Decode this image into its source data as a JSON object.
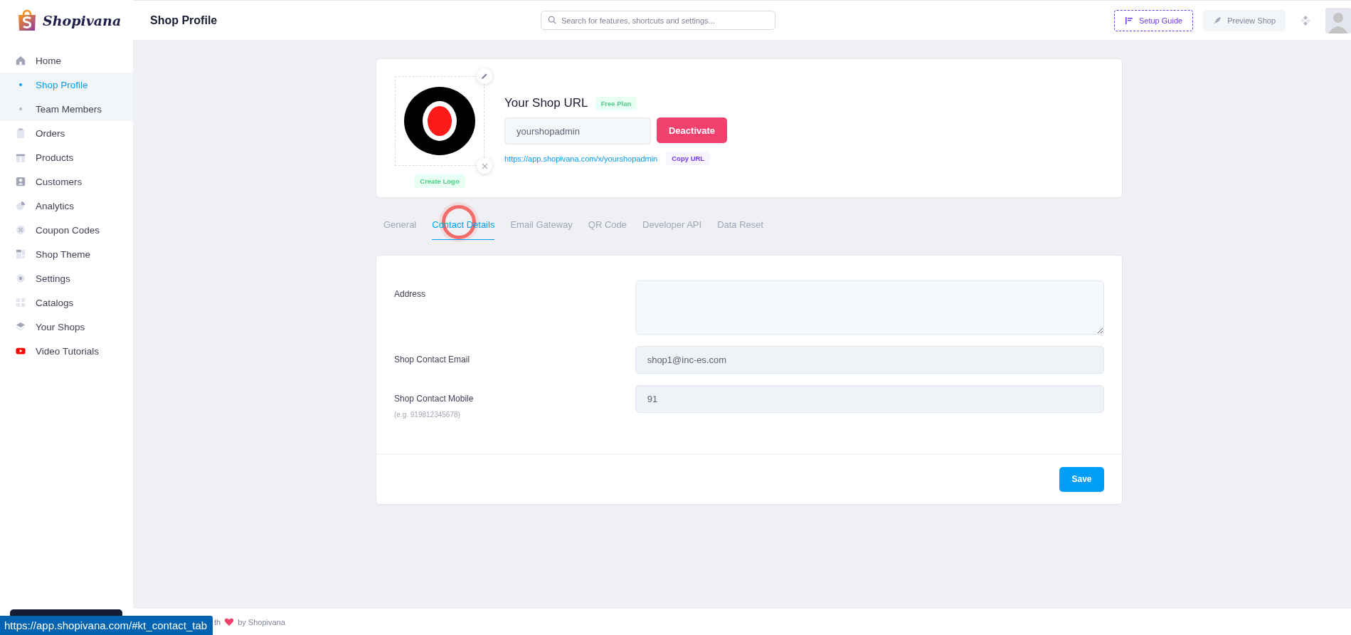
{
  "brand": {
    "name": "Shopivana"
  },
  "sidebar": {
    "items": [
      {
        "label": "Home",
        "kind": "item",
        "selected": false
      },
      {
        "label": "Shop Profile",
        "kind": "subitem",
        "selected": true
      },
      {
        "label": "Team Members",
        "kind": "subitem",
        "selected": false
      },
      {
        "label": "Orders",
        "kind": "item",
        "selected": false
      },
      {
        "label": "Products",
        "kind": "item",
        "selected": false
      },
      {
        "label": "Customers",
        "kind": "item",
        "selected": false
      },
      {
        "label": "Analytics",
        "kind": "item",
        "selected": false
      },
      {
        "label": "Coupon Codes",
        "kind": "item",
        "selected": false
      },
      {
        "label": "Shop Theme",
        "kind": "item",
        "selected": false
      },
      {
        "label": "Settings",
        "kind": "item",
        "selected": false
      },
      {
        "label": "Catalogs",
        "kind": "item",
        "selected": false
      },
      {
        "label": "Your Shops",
        "kind": "item",
        "selected": false
      },
      {
        "label": "Video Tutorials",
        "kind": "item",
        "selected": false
      }
    ]
  },
  "header": {
    "title": "Shop Profile",
    "search": {
      "placeholder": "Search for features, shortcuts and settings..."
    },
    "setup_guide": "Setup Guide",
    "preview_shop": "Preview Shop"
  },
  "profile": {
    "create_logo": "Create Logo",
    "title": "Your Shop URL",
    "plan": "Free Plan",
    "slug": "yourshopadmin",
    "deactivate": "Deactivate",
    "url": "https://app.shopivana.com/x/yourshopadmin",
    "copy_url": "Copy URL"
  },
  "tabs": [
    {
      "label": "General",
      "selected": false
    },
    {
      "label": "Contact Details",
      "selected": true
    },
    {
      "label": "Email Gateway",
      "selected": false
    },
    {
      "label": "QR Code",
      "selected": false
    },
    {
      "label": "Developer API",
      "selected": false
    },
    {
      "label": "Data Reset",
      "selected": false
    }
  ],
  "form": {
    "fields": [
      {
        "label": "Address",
        "kind": "textarea"
      },
      {
        "label": "Shop Contact Email",
        "kind": "input",
        "value": "shop1@inc-es.com"
      },
      {
        "label": "Shop Contact Mobile",
        "kind": "input",
        "value": "91",
        "hint": "(e.g. 919812345678)"
      }
    ],
    "save": "Save"
  },
  "footer": {
    "lead": "th",
    "by": "by Shopivana"
  },
  "status_bar": {
    "url": "https://app.shopivana.com/#kt_contact_tab"
  }
}
